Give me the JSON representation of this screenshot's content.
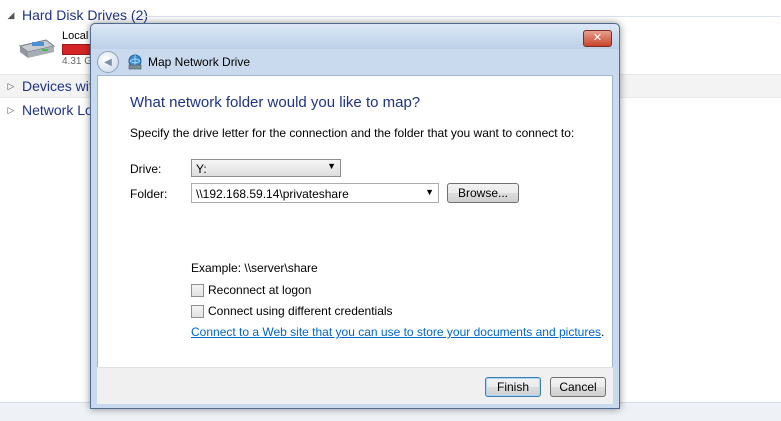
{
  "explorer": {
    "hard_disk_header": "Hard Disk Drives (2)",
    "drive_name": "Local I",
    "drive_free_text": "4.31 G",
    "devices_header": "Devices with",
    "network_header": "Network Loc"
  },
  "dialog": {
    "title": "Map Network Drive",
    "close_glyph": "✕",
    "heading": "What network folder would you like to map?",
    "description": "Specify the drive letter for the connection and the folder that you want to connect to:",
    "drive_label": "Drive:",
    "drive_value": "Y:",
    "folder_label": "Folder:",
    "folder_value": "\\\\192.168.59.14\\privateshare",
    "browse_label": "Browse...",
    "example_text": "Example: \\\\server\\share",
    "reconnect_label": "Reconnect at logon",
    "reconnect_checked": false,
    "credentials_label": "Connect using different credentials",
    "credentials_checked": false,
    "web_link": "Connect to a Web site that you can use to store your documents and pictures",
    "link_period": ".",
    "finish_label": "Finish",
    "cancel_label": "Cancel"
  },
  "colors": {
    "heading": "#1e3287",
    "link": "#0066cc",
    "drive_bar": "#d42626"
  }
}
